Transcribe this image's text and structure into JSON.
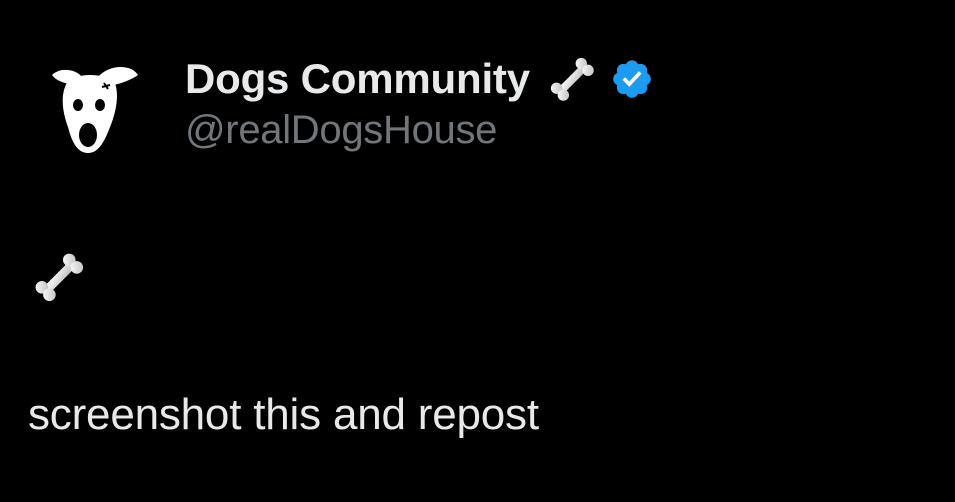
{
  "author": {
    "display_name": "Dogs Community",
    "handle": "@realDogsHouse",
    "avatar_icon": "dog-face-icon",
    "name_emoji_icon": "bone-icon",
    "verified_icon": "verified-badge-icon"
  },
  "tweet": {
    "emoji_icon": "bone-icon",
    "text": "screenshot this and repost"
  },
  "colors": {
    "background": "#000000",
    "primary_text": "#e7e9ea",
    "secondary_text": "#71767b",
    "verified_blue": "#1d9bf0"
  }
}
